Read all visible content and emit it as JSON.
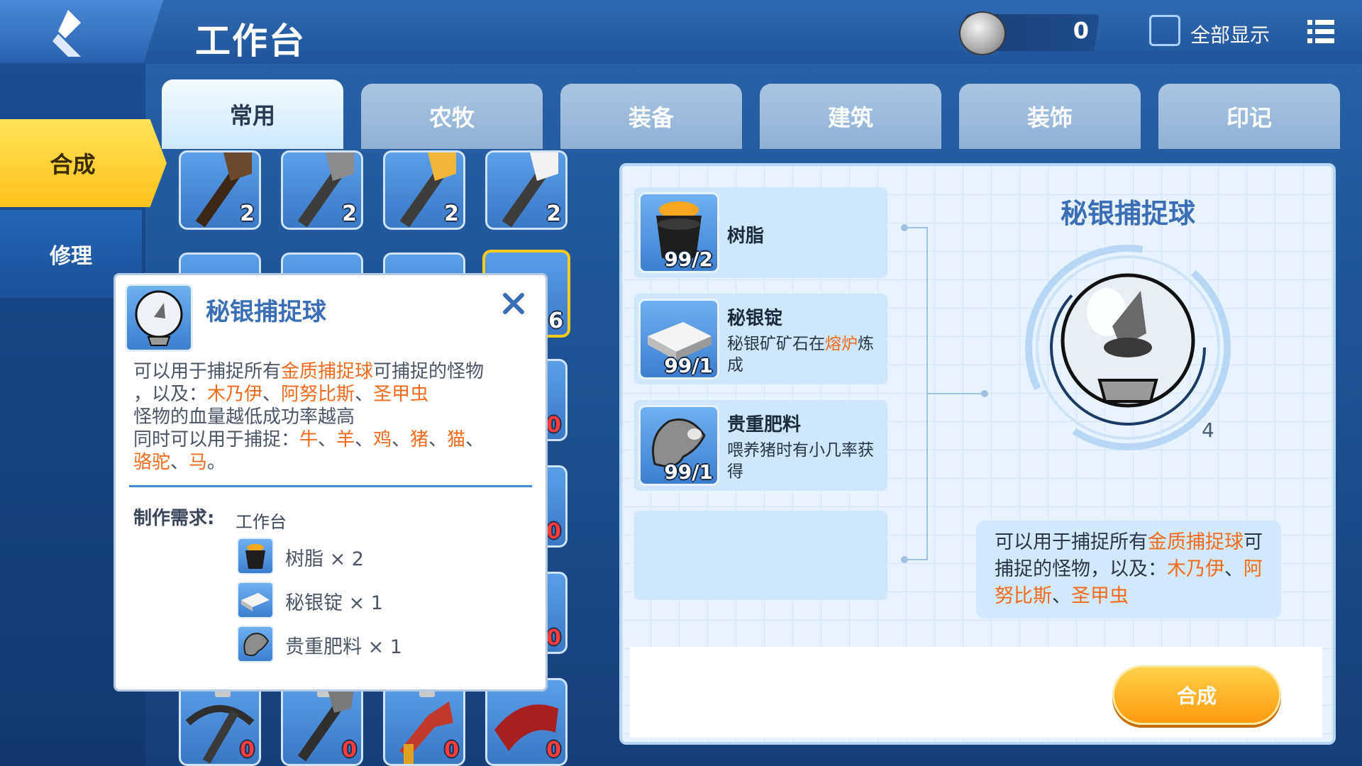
{
  "header": {
    "title": "工作台",
    "coins": "0",
    "show_all_label": "全部显示"
  },
  "side_tabs": [
    {
      "label": "合成",
      "active": true
    },
    {
      "label": "修理",
      "active": false
    }
  ],
  "category_tabs": [
    {
      "label": "常用",
      "active": true
    },
    {
      "label": "农牧",
      "active": false
    },
    {
      "label": "装备",
      "active": false
    },
    {
      "label": "建筑",
      "active": false
    },
    {
      "label": "装饰",
      "active": false
    },
    {
      "label": "印记",
      "active": false
    }
  ],
  "grid": {
    "row1_counts": [
      "2",
      "2",
      "2",
      "2"
    ],
    "selected_count": "6",
    "side_counts": [
      "0",
      "0",
      "0"
    ],
    "bottom_counts": [
      "0",
      "0",
      "0",
      "0"
    ]
  },
  "tooltip": {
    "title": "秘银捕捉球",
    "desc_1a": "可以用于捕捉所有",
    "desc_1b": "金质捕捉球",
    "desc_1c": "可捕捉的怪物",
    "desc_2a": "，以及：",
    "desc_2b": "木乃伊",
    "desc_2c": "、",
    "desc_2d": "阿努比斯",
    "desc_2e": "、",
    "desc_2f": "圣甲虫",
    "desc_3": "怪物的血量越低成功率越高",
    "desc_4a": "同时可以用于捕捉：",
    "desc_4b": "牛",
    "desc_4c": "、",
    "desc_4d": "羊",
    "desc_4e": "、",
    "desc_4f": "鸡",
    "desc_4g": "、",
    "desc_4h": "猪",
    "desc_4i": "、",
    "desc_4j": "猫",
    "desc_4k": "、",
    "desc_5a": "骆驼",
    "desc_5b": "、",
    "desc_5c": "马",
    "desc_5d": "。",
    "req_label": "制作需求:",
    "req_station": "工作台",
    "requirements": [
      {
        "text": "树脂 × 2"
      },
      {
        "text": "秘银锭 × 1"
      },
      {
        "text": "贵重肥料 × 1"
      }
    ]
  },
  "materials": [
    {
      "name": "树脂",
      "count": "99/2",
      "desc_a": "",
      "desc_b": "",
      "desc_c": ""
    },
    {
      "name": "秘银锭",
      "count": "99/1",
      "desc_a": "秘银矿矿石在",
      "desc_b": "熔炉",
      "desc_c": "炼成"
    },
    {
      "name": "贵重肥料",
      "count": "99/1",
      "desc_a": "喂养猪时有小几率获得",
      "desc_b": "",
      "desc_c": ""
    }
  ],
  "result": {
    "title": "秘银捕捉球",
    "count": "4",
    "info_a": "可以用于捕捉所有",
    "info_b": "金质捕捉球",
    "info_c": "可捕捉的怪物，以及：",
    "info_d": "木乃伊",
    "info_e": "、",
    "info_f": "阿努比斯",
    "info_g": "、",
    "info_h": "圣甲虫"
  },
  "craft_button": "合成",
  "colors": {
    "highlight": "#f26a1b",
    "accent_blue": "#3a6fb6",
    "active_yellow": "#ffc21a"
  }
}
